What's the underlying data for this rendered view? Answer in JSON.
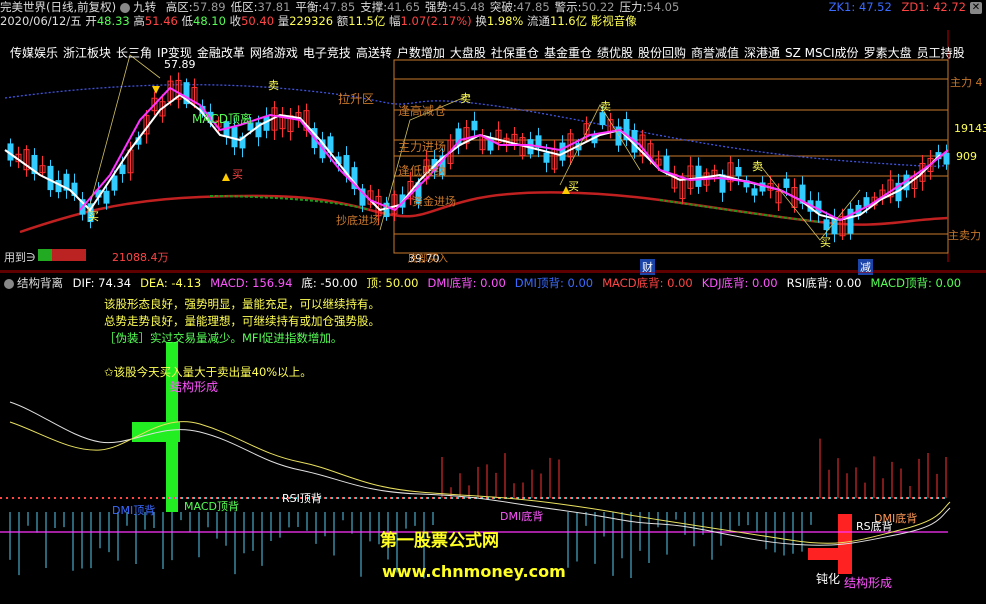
{
  "window": {
    "title": "完美世界(日线,前复权)"
  },
  "price_header": {
    "indicator": "九转",
    "items": [
      {
        "label": "高区:",
        "value": "57.89",
        "color": "#9a9a9a"
      },
      {
        "label": "低区:",
        "value": "37.81",
        "color": "#9a9a9a"
      },
      {
        "label": "平衡:",
        "value": "47.85",
        "color": "#9a9a9a"
      },
      {
        "label": "支撑:",
        "value": "41.65",
        "color": "#9a9a9a"
      },
      {
        "label": "强势:",
        "value": "45.48",
        "color": "#9a9a9a"
      },
      {
        "label": "突破:",
        "value": "47.85",
        "color": "#9a9a9a"
      },
      {
        "label": "警示:",
        "value": "50.22",
        "color": "#9a9a9a"
      },
      {
        "label": "压力:",
        "value": "54.05",
        "color": "#9a9a9a"
      }
    ],
    "zk": "ZK1: 47.52",
    "zd": "ZD1: 42.72"
  },
  "quote": {
    "date": "2020/06/12/五",
    "open_label": "开",
    "open": "48.33",
    "high_label": "高",
    "high": "51.46",
    "low_label": "低",
    "low": "48.10",
    "close_label": "收",
    "close": "50.40",
    "vol_label": "量",
    "vol": "229326",
    "amount_label": "额",
    "amount": "11.5亿",
    "change_label": "幅",
    "change": "1.07(2.17%)",
    "turnover_label": "换",
    "turnover": "1.98%",
    "float_label": "流通",
    "float": "11.6亿",
    "concept": "影视音像"
  },
  "concepts": [
    "传媒娱乐",
    "浙江板块",
    "长三角",
    "IP变现",
    "金融改革",
    "网络游戏",
    "电子竞技",
    "高送转",
    "户数增加",
    "大盘股",
    "社保重仓",
    "基金重仓",
    "绩优股",
    "股份回购",
    "商誉减值",
    "深港通",
    "SZ MSCI成份",
    "罗素大盘",
    "员工持股"
  ],
  "chart_labels": {
    "price_high": "57.89",
    "price_low": "39.70",
    "right_19143": "19143",
    "right_909": "909",
    "zone_labels": [
      "拉升区",
      "逢高减仓",
      "主力进场",
      "逢低吸纳",
      "资金进场",
      "底部买入",
      "抄底进场",
      "主力进"
    ],
    "right_zones": [
      "主力 4",
      "主卖力"
    ],
    "sell": "卖",
    "buy": "买",
    "used_to": "用到∋",
    "volume_value": "21088.4万",
    "events": [
      "财",
      "减"
    ],
    "macd_top": "MACD顶离"
  },
  "indicator_header": {
    "name": "结构背离",
    "items": [
      {
        "label": "DIF:",
        "value": "74.34",
        "color": "#ffffff"
      },
      {
        "label": "DEA:",
        "value": "-4.13",
        "color": "#ffff55"
      },
      {
        "label": "MACD:",
        "value": "156.94",
        "color": "#ff55ff"
      },
      {
        "label": "底:",
        "value": "-50.00",
        "color": "#ffffff"
      },
      {
        "label": "顶:",
        "value": "50.00",
        "color": "#ffff55"
      },
      {
        "label": "DMI底背:",
        "value": "0.00",
        "color": "#ff55ff"
      },
      {
        "label": "DMI顶背:",
        "value": "0.00",
        "color": "#3a6bff"
      },
      {
        "label": "MACD底背:",
        "value": "0.00",
        "color": "#ff4444"
      },
      {
        "label": "KDJ底背:",
        "value": "0.00",
        "color": "#ff55ff"
      },
      {
        "label": "RSI底背:",
        "value": "0.00",
        "color": "#ffffff"
      },
      {
        "label": "MACD顶背:",
        "value": "0.00",
        "color": "#55ff55"
      }
    ]
  },
  "messages": [
    {
      "text": "该股形态良好，强势明显，量能充足，可以继续持有。",
      "color": "#ffff55"
    },
    {
      "text": "总势走势良好，量能理想，可继续持有或加仓强势股。",
      "color": "#ffff55"
    },
    {
      "text": "［伪装］实过交易量减少。MFI促进指数增加。",
      "color": "#55ff55"
    },
    {
      "text": "✩该股今天买入量大于卖出量40%以上。",
      "color": "#ffff55"
    }
  ],
  "indicator_labels": {
    "structure_form": "结构形成",
    "dmi_top": "DMI顶背",
    "macd_top": "MACD顶背",
    "dmi_bottom": "DMI底背",
    "rsi_top": "RSI顶背",
    "dmi_bottom2": "DMI底背",
    "rs_bottom": "RS底背",
    "dun": "钝化",
    "structure_form2": "结构形成"
  },
  "watermark": {
    "title": "第一股票公式网",
    "url": "www.chnmoney.com"
  }
}
